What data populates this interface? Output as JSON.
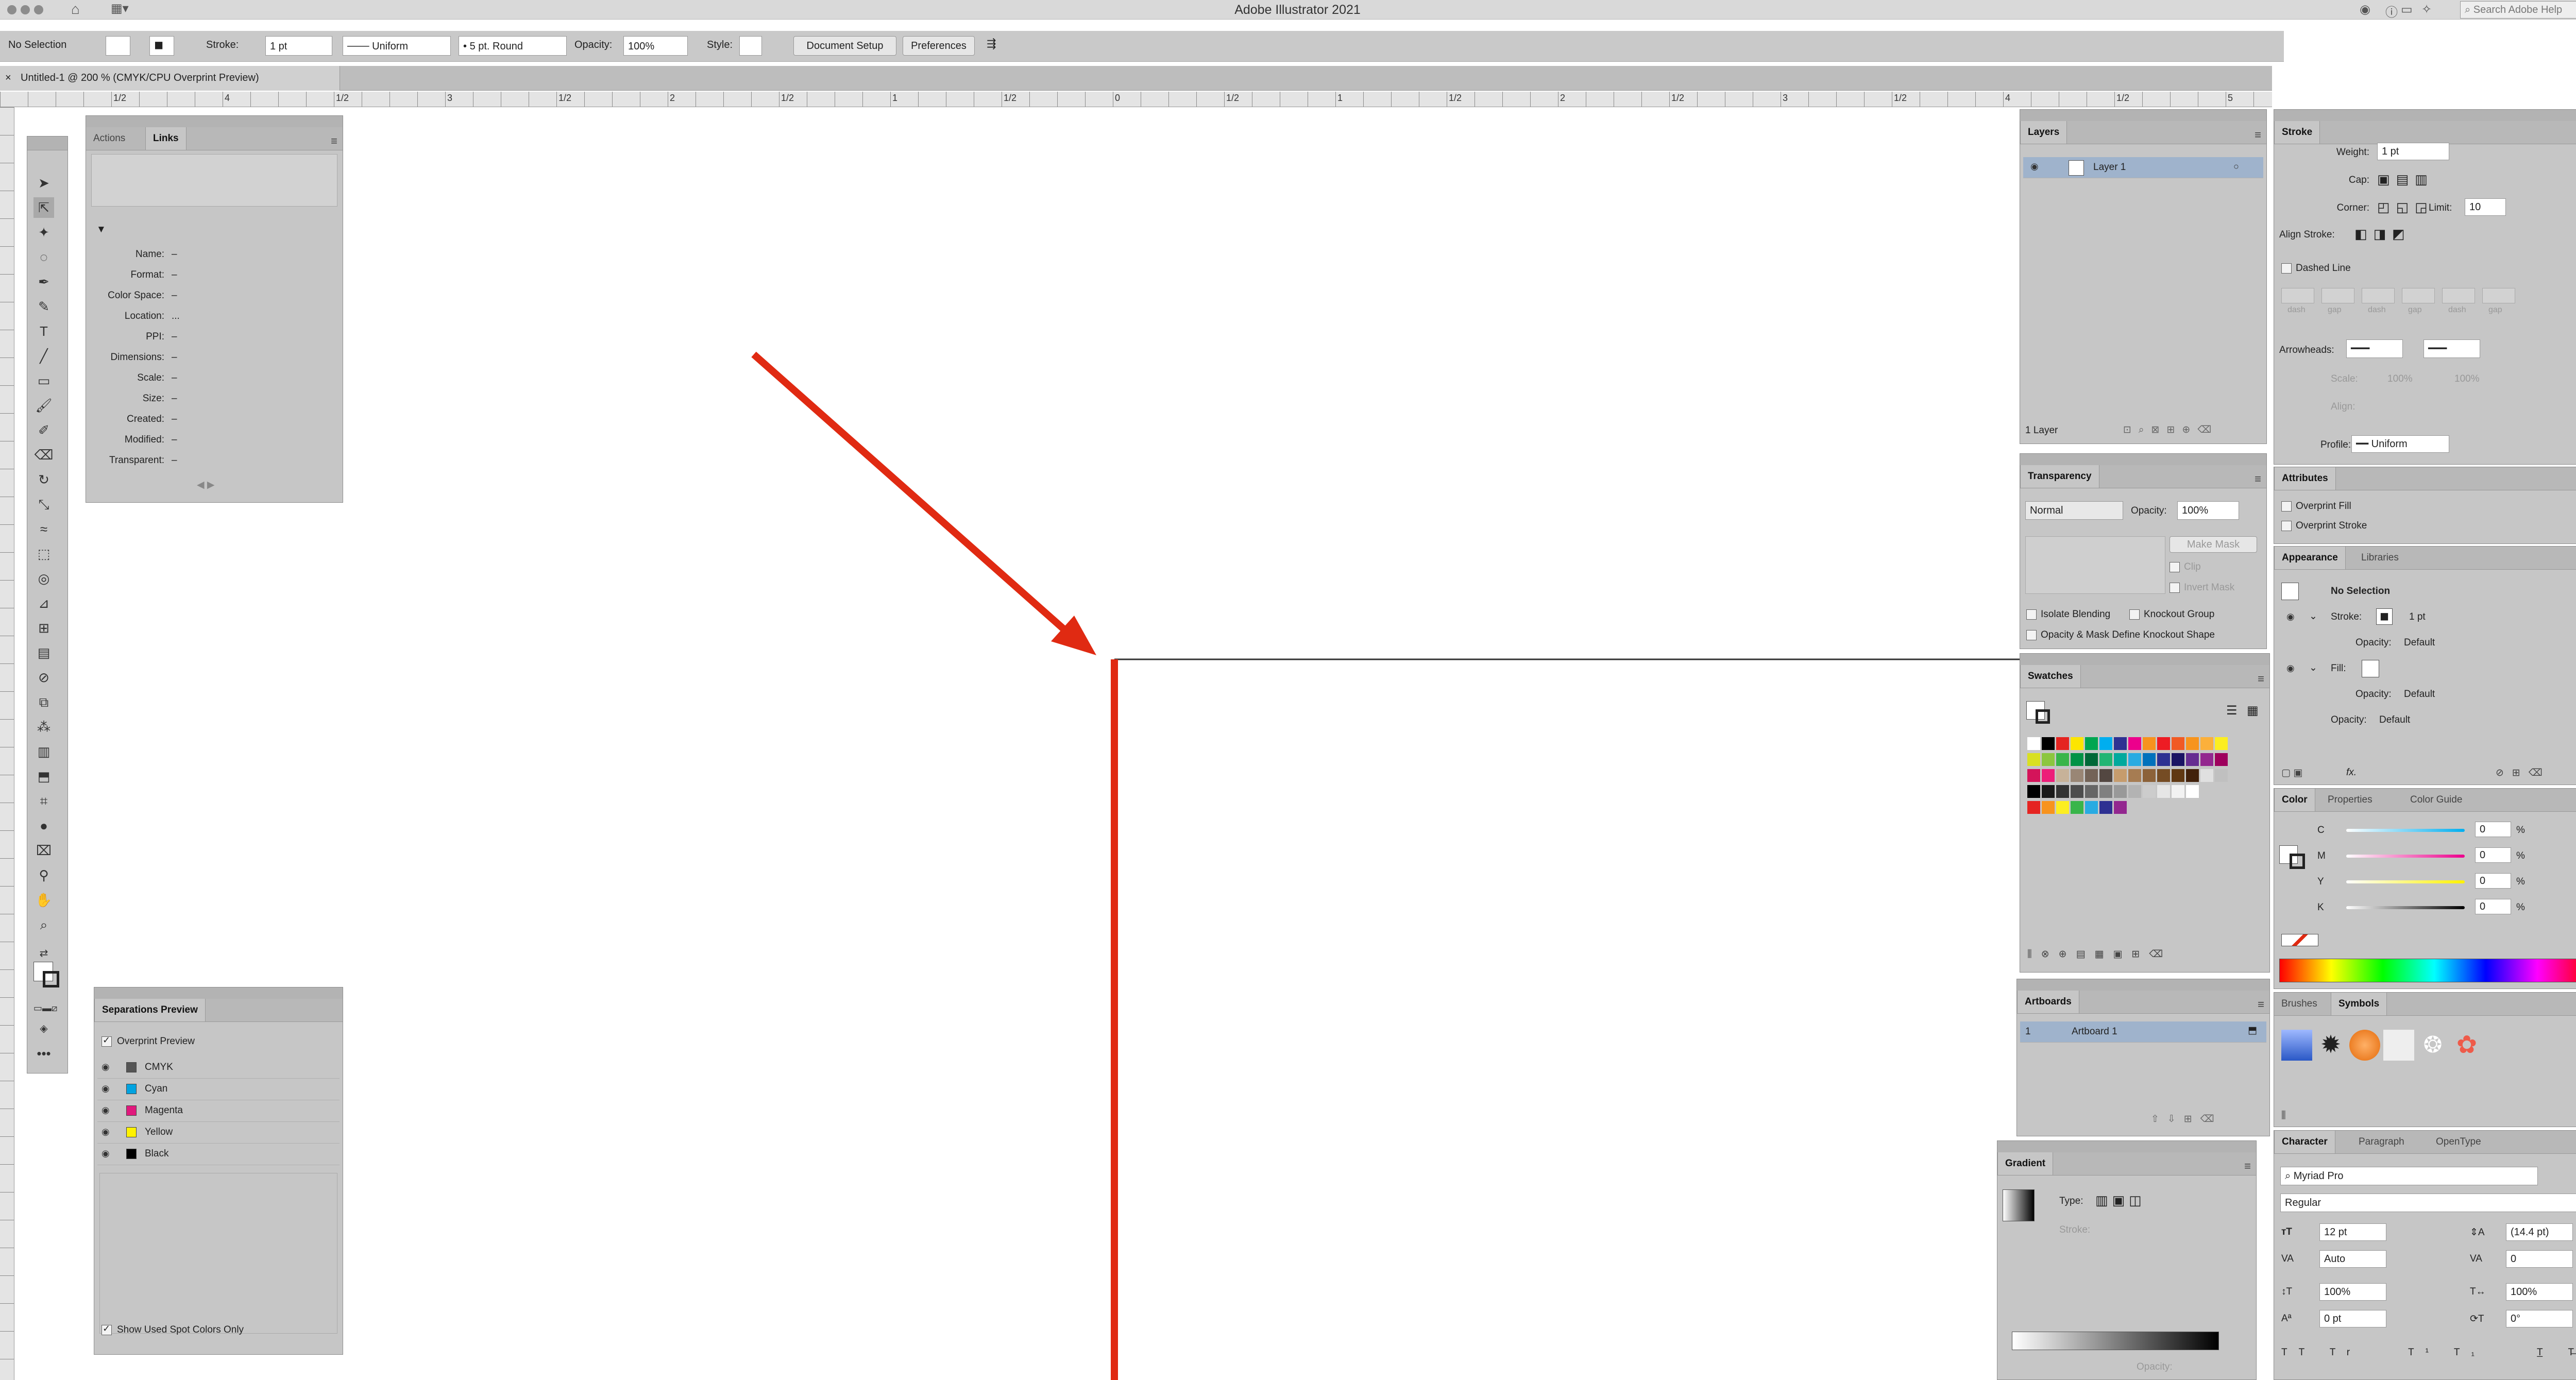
{
  "app": {
    "title": "Adobe Illustrator 2021",
    "search_placeholder": "Search Adobe Help"
  },
  "control_bar": {
    "selection": "No Selection",
    "stroke_label": "Stroke:",
    "stroke_weight": "1 pt",
    "profile": "Uniform",
    "brush": "5 pt. Round",
    "opacity_label": "Opacity:",
    "opacity": "100%",
    "style_label": "Style:",
    "document_setup": "Document Setup",
    "preferences": "Preferences"
  },
  "document_tab": {
    "label": "Untitled-1 @ 200 % (CMYK/CPU Overprint Preview)"
  },
  "ruler_labels": [
    "1/2",
    "4",
    "1/2",
    "3",
    "1/2",
    "2",
    "1/2",
    "1",
    "1/2",
    "0",
    "1/2",
    "1",
    "1/2",
    "2",
    "1/2",
    "3",
    "1/2",
    "4",
    "1/2",
    "5"
  ],
  "links_panel": {
    "tabs": [
      "Actions",
      "Links"
    ],
    "fields": [
      {
        "label": "Name:",
        "value": "–"
      },
      {
        "label": "Format:",
        "value": "–"
      },
      {
        "label": "Color Space:",
        "value": "–"
      },
      {
        "label": "Location:",
        "value": "..."
      },
      {
        "label": "PPI:",
        "value": "–"
      },
      {
        "label": "Dimensions:",
        "value": "–"
      },
      {
        "label": "Scale:",
        "value": "–"
      },
      {
        "label": "Size:",
        "value": "–"
      },
      {
        "label": "Created:",
        "value": "–"
      },
      {
        "label": "Modified:",
        "value": "–"
      },
      {
        "label": "Transparent:",
        "value": "–"
      }
    ]
  },
  "separations_panel": {
    "title": "Separations Preview",
    "overprint_preview": "Overprint Preview",
    "inks": [
      {
        "name": "CMYK",
        "color": "#555555"
      },
      {
        "name": "Cyan",
        "color": "#00a3e0"
      },
      {
        "name": "Magenta",
        "color": "#e0197d"
      },
      {
        "name": "Yellow",
        "color": "#fff200"
      },
      {
        "name": "Black",
        "color": "#000000"
      }
    ],
    "show_spot": "Show Used Spot Colors Only"
  },
  "layers_panel": {
    "title": "Layers",
    "layer_name": "Layer 1",
    "count": "1 Layer"
  },
  "transparency_panel": {
    "title": "Transparency",
    "blend_mode": "Normal",
    "opacity_label": "Opacity:",
    "opacity": "100%",
    "make_mask": "Make Mask",
    "clip": "Clip",
    "invert_mask": "Invert Mask",
    "isolate": "Isolate Blending",
    "knockout": "Knockout Group",
    "define_knockout": "Opacity & Mask Define Knockout Shape"
  },
  "swatches_panel": {
    "title": "Swatches",
    "row1": [
      "#ffffff",
      "#000000",
      "#e52421",
      "#fce500",
      "#00a651",
      "#00aeef",
      "#2e3192",
      "#ec008c",
      "#f7931e",
      "#ed1c24",
      "#f15a24",
      "#f7941d",
      "#fbb03b",
      "#fcee21"
    ],
    "row2": [
      "#d9e021",
      "#8cc63f",
      "#39b54a",
      "#009245",
      "#006837",
      "#22b573",
      "#00a99d",
      "#29abe2",
      "#0071bc",
      "#2e3192",
      "#1b1464",
      "#662d91",
      "#93278f",
      "#9e005d"
    ],
    "row3": [
      "#d4145a",
      "#ed1e79",
      "#c7b299",
      "#998675",
      "#736357",
      "#534741",
      "#c69c6d",
      "#a67c52",
      "#8c6239",
      "#754c24",
      "#603813",
      "#42210b",
      "#e0e0e0",
      "#c0c0c0"
    ],
    "row4": [
      "#000000",
      "#1a1a1a",
      "#333333",
      "#4d4d4d",
      "#666666",
      "#808080",
      "#999999",
      "#b3b3b3",
      "#cccccc",
      "#e6e6e6",
      "#f2f2f2",
      "#ffffff"
    ],
    "row5": [
      "#e52421",
      "#f7931e",
      "#fcee21",
      "#39b54a",
      "#29abe2",
      "#2e3192",
      "#93278f"
    ]
  },
  "artboards_panel": {
    "title": "Artboards",
    "number": "1",
    "name": "Artboard 1"
  },
  "gradient_panel": {
    "title": "Gradient",
    "type_label": "Type:",
    "stroke_label": "Stroke:",
    "opacity_label": "Opacity:"
  },
  "stroke_panel": {
    "title": "Stroke",
    "weight_label": "Weight:",
    "weight": "1 pt",
    "cap_label": "Cap:",
    "corner_label": "Corner:",
    "limit_label": "Limit:",
    "limit": "10",
    "align_label": "Align Stroke:",
    "dashed": "Dashed Line",
    "dash_labels": [
      "dash",
      "gap",
      "dash",
      "gap",
      "dash",
      "gap"
    ],
    "arrowheads": "Arrowheads:",
    "scale": "Scale:",
    "scale1": "100%",
    "scale2": "100%",
    "align": "Align:",
    "profile_label": "Profile:",
    "profile": "Uniform"
  },
  "attributes_panel": {
    "title": "Attributes",
    "overprint_fill": "Overprint Fill",
    "overprint_stroke": "Overprint Stroke"
  },
  "appearance_panel": {
    "tabs": [
      "Appearance",
      "Libraries"
    ],
    "selection": "No Selection",
    "stroke_label": "Stroke:",
    "stroke_value": "1 pt",
    "opacity_label": "Opacity:",
    "opacity_value": "Default",
    "fill_label": "Fill:",
    "fill_opacity_label": "Opacity:",
    "fill_opacity_value": "Default",
    "opacity2_label": "Opacity:",
    "opacity2_value": "Default",
    "fx": "fx."
  },
  "color_panel": {
    "tabs": [
      "Color",
      "Properties",
      "Color Guide"
    ],
    "channels": [
      {
        "name": "C",
        "value": "0",
        "pct": "%",
        "color": "#00aeef"
      },
      {
        "name": "M",
        "value": "0",
        "pct": "%",
        "color": "#ec008c"
      },
      {
        "name": "Y",
        "value": "0",
        "pct": "%",
        "color": "#fff200"
      },
      {
        "name": "K",
        "value": "0",
        "pct": "%",
        "color": "#000000"
      }
    ]
  },
  "brushes_panel": {
    "tabs": [
      "Brushes",
      "Symbols"
    ]
  },
  "character_panel": {
    "tabs": [
      "Character",
      "Paragraph",
      "OpenType"
    ],
    "font": "Myriad Pro",
    "style": "Regular",
    "size": "12 pt",
    "leading": "(14.4 pt)",
    "kerning": "Auto",
    "tracking": "0",
    "vscale": "100%",
    "hscale": "100%",
    "baseline": "0 pt",
    "rotation": "0°"
  },
  "colors": {
    "arrow": "#e02a12",
    "artboard_edge": "#e02a12",
    "panel_bg": "#c6c6c6",
    "selection": "#9fb3cc"
  }
}
